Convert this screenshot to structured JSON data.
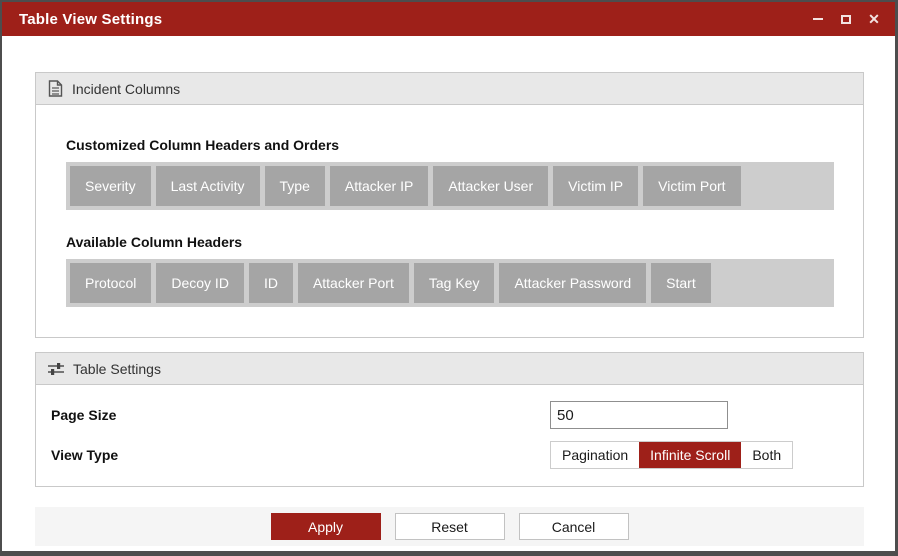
{
  "window": {
    "title": "Table View Settings",
    "icons": {
      "close": "✕"
    }
  },
  "colors": {
    "accent_red": "#9e2019",
    "chip_gray": "#a5a5a5",
    "tray_gray": "#cdcdcd",
    "section_header_gray": "#e8e8e8",
    "footer_gray": "#f5f5f5",
    "window_border": "#4d4d4d"
  },
  "sections": {
    "incident_columns": {
      "title": "Incident Columns",
      "customized_label": "Customized Column Headers and Orders",
      "customized_columns": [
        "Severity",
        "Last Activity",
        "Type",
        "Attacker IP",
        "Attacker User",
        "Victim IP",
        "Victim Port"
      ],
      "available_label": "Available Column Headers",
      "available_columns": [
        "Protocol",
        "Decoy ID",
        "ID",
        "Attacker Port",
        "Tag Key",
        "Attacker Password",
        "Start"
      ]
    },
    "table_settings": {
      "title": "Table Settings",
      "page_size_label": "Page Size",
      "page_size_value": "50",
      "view_type_label": "View Type",
      "view_type_options": [
        "Pagination",
        "Infinite Scroll",
        "Both"
      ],
      "view_type_selected": "Infinite Scroll"
    }
  },
  "footer": {
    "apply_label": "Apply",
    "reset_label": "Reset",
    "cancel_label": "Cancel"
  }
}
